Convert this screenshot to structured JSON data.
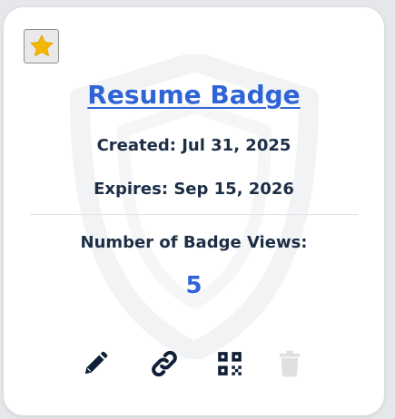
{
  "badge": {
    "title": "Resume Badge",
    "created": "Created: Jul 31, 2025",
    "expires": "Expires: Sep 15, 2026",
    "views_label": "Number of Badge Views:",
    "views_count": "5"
  },
  "icons": {
    "favorite": "star-icon",
    "edit": "pencil-icon",
    "link": "link-icon",
    "qr": "qr-code-icon",
    "delete": "trash-icon",
    "watermark": "shield-icon"
  },
  "colors": {
    "accent": "#2f64d6",
    "text": "#1c2e46",
    "star": "#f5b800",
    "disabled": "#e0e0e0"
  }
}
